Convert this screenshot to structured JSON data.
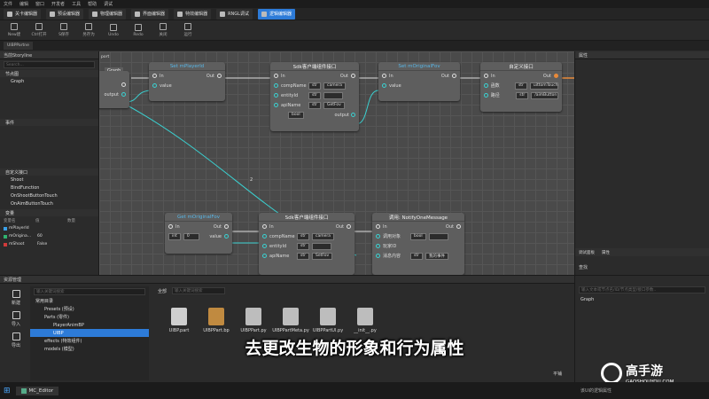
{
  "menu": [
    "文件",
    "编辑",
    "窗口",
    "开发者",
    "工具",
    "帮助",
    "调试"
  ],
  "editors": [
    {
      "label": "关卡编辑器",
      "active": false
    },
    {
      "label": "预设编辑器",
      "active": false
    },
    {
      "label": "物理编辑器",
      "active": false
    },
    {
      "label": "界面编辑器",
      "active": false
    },
    {
      "label": "特效编辑器",
      "active": false
    },
    {
      "label": "RNGL调试",
      "active": false
    },
    {
      "label": "逻辑编辑器",
      "active": true
    }
  ],
  "toolbar": [
    "New建",
    "Ctrl打开",
    "S保存",
    "另存为",
    "Undo",
    "Redo",
    "关闭",
    "运行"
  ],
  "file_tab": "UIBPPartne",
  "left": {
    "title": "当前Storyline",
    "search_placeholder": "Search...",
    "nodes_section": "节点图",
    "graph_item": "Graph",
    "events_section": "事件",
    "custom_section": "自定义接口",
    "custom_items": [
      "Shoot",
      "BindFunction",
      "OnShootButtonTouch",
      "OnAimButtonTouch"
    ],
    "vars_section": "变量",
    "vars_header": [
      "变量名",
      "值",
      "数量"
    ],
    "vars": [
      {
        "name": "mPlayerId",
        "value": "",
        "color": "#3aa0e8"
      },
      {
        "name": "mOrigina...",
        "value": "60",
        "color": "#2fb36e"
      },
      {
        "name": "mShoot",
        "value": "False",
        "color": "#d13a3a"
      }
    ]
  },
  "canvas": {
    "graph_tab": "Graph",
    "port_label": "port",
    "nodes": {
      "n_left": {
        "out": "output"
      },
      "n_setplayer": {
        "title": "Set mPlayerId",
        "in": "In",
        "out": "Out",
        "value": "value"
      },
      "n_sdk1": {
        "title": "Sdk客户端组件接口",
        "in": "In",
        "out": "Out",
        "rows": [
          [
            "compName",
            "str",
            "camera"
          ],
          [
            "entityId",
            "str",
            ""
          ],
          [
            "apiName",
            "str",
            "GetFov"
          ]
        ],
        "bool": "bool",
        "output": "output"
      },
      "n_setfov": {
        "title": "Set mOriginalFov",
        "in": "In",
        "out": "Out",
        "value": "value"
      },
      "n_custom": {
        "title": "自定义接口",
        "in": "In",
        "out": "Out",
        "rows": [
          [
            "函数",
            "str",
            "uittomTouch"
          ],
          [
            "路径",
            "str",
            "/aimButton"
          ]
        ]
      },
      "n_getfov": {
        "title": "Get mOriginalFov",
        "in": "In",
        "out": "Out",
        "dtype": "int",
        "num": "0",
        "value": "value"
      },
      "n_sdk2": {
        "title": "Sdk客户端组件接口",
        "in": "In",
        "out": "Out",
        "rows": [
          [
            "compName",
            "str",
            "camera"
          ],
          [
            "entityId",
            "str",
            ""
          ],
          [
            "apiName",
            "str",
            "SetFov"
          ]
        ]
      },
      "n_notify": {
        "title": "调用: NotifyOneMessage",
        "in": "In",
        "out": "Out",
        "rows": [
          [
            "调用对象",
            "bool",
            ""
          ],
          [
            "玩家ID",
            ""
          ],
          [
            "消息内容",
            "str",
            "我的事件"
          ]
        ]
      }
    },
    "edge_label": "2"
  },
  "right": {
    "title": "属性",
    "bottom_tabs": [
      "调试面板",
      "属性"
    ],
    "find_title": "查找",
    "find_placeholder": "输入文本或节点名/ID/节点类型/接口参数..",
    "graph_item": "Graph"
  },
  "bottom": {
    "title": "资源管理",
    "side": [
      "新建",
      "导入",
      "导出"
    ],
    "search_placeholder": "输入关键词搜索",
    "tree": [
      {
        "label": "常用目录",
        "indent": 0,
        "sel": false
      },
      {
        "label": "Presets  (预设)",
        "indent": 1,
        "sel": false
      },
      {
        "label": "Parts  (零件)",
        "indent": 1,
        "sel": false
      },
      {
        "label": "PlayerAnimBP",
        "indent": 2,
        "sel": false
      },
      {
        "label": "UIBP",
        "indent": 2,
        "sel": true
      },
      {
        "label": "effects  (特效组件)",
        "indent": 1,
        "sel": false
      },
      {
        "label": "models  (模型)",
        "indent": 1,
        "sel": false
      }
    ],
    "all_label": "全部",
    "asset_search_placeholder": "输入关键词搜索",
    "assets": [
      {
        "name": "UIBP.part",
        "icon": "puzzle-icon",
        "color": "#cfcfcf"
      },
      {
        "name": "UIBPPart.bp",
        "icon": "clipboard-icon",
        "color": "#c08a40"
      },
      {
        "name": "UIBPPart.py",
        "icon": "python-icon",
        "color": "#bdbdbd"
      },
      {
        "name": "UIBPPartMeta.py",
        "icon": "python-icon",
        "color": "#bdbdbd"
      },
      {
        "name": "UIBPPartUI.py",
        "icon": "python-icon",
        "color": "#bdbdbd"
      },
      {
        "name": "__init__.py",
        "icon": "python-icon",
        "color": "#bdbdbd"
      }
    ],
    "footer": "平铺"
  },
  "subtitle": "去更改生物的形象和行为属性",
  "watermark": {
    "name": "高手游",
    "url": "GAOSHOUYOU.COM"
  },
  "taskbar": {
    "app": "MC_Editor",
    "status": "该UI的逻辑属性"
  }
}
